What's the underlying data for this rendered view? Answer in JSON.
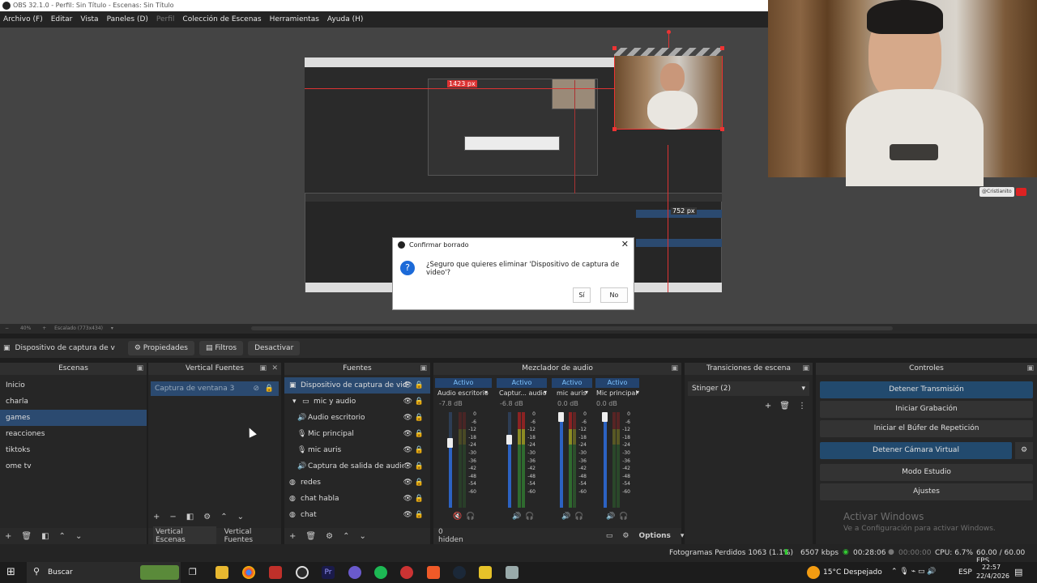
{
  "window": {
    "title": "OBS 32.1.0 - Perfil: Sin Título - Escenas: Sin Título"
  },
  "menu": [
    "Archivo (F)",
    "Editar",
    "Vista",
    "Paneles (D)",
    "Perfil",
    "Colección de Escenas",
    "Herramientas",
    "Ayuda (H)"
  ],
  "preview": {
    "width_label": "1423 px",
    "height_label": "752 px",
    "zoom": "40%",
    "scaled": "Escalado (773x434)",
    "watermark": "@Cristianito"
  },
  "dialog": {
    "title": "Confirmar borrado",
    "message": "¿Seguro que quieres eliminar 'Dispositivo de captura de video'?",
    "yes": "Sí",
    "no": "No"
  },
  "source_toolbar": {
    "selected": "Dispositivo de captura de v",
    "properties": "Propiedades",
    "filters": "Filtros",
    "deactivate": "Desactivar"
  },
  "scenes": {
    "title": "Escenas",
    "items": [
      "Inicio",
      "charla",
      "games",
      "reacciones",
      "tiktoks",
      "ome tv"
    ],
    "selected_index": 2
  },
  "vertical_sources": {
    "title": "Vertical Fuentes",
    "items": [
      "Captura de ventana 3"
    ],
    "tab1": "Vertical Escenas",
    "tab2": "Vertical Fuentes"
  },
  "sources": {
    "title": "Fuentes",
    "items": [
      "Dispositivo de captura de vid",
      "mic y audio",
      "Audio escritorio",
      "Mic principal",
      "mic auris",
      "Captura de salida de audio",
      "redes",
      "chat habla",
      "chat"
    ]
  },
  "mixer": {
    "title": "Mezclador de audio",
    "hidden": "0 hidden",
    "options": "Options",
    "channels": [
      {
        "active": "Activo",
        "name": "Audio escritorio",
        "db": "-7.8 dB"
      },
      {
        "active": "Activo",
        "name": "Captur... audio",
        "db": "-6.8 dB"
      },
      {
        "active": "Activo",
        "name": "mic auris",
        "db": "0.0 dB"
      },
      {
        "active": "Activo",
        "name": "Mic principal",
        "db": "0.0 dB"
      }
    ],
    "scale": [
      "0",
      "-6",
      "-12",
      "-18",
      "-24",
      "-30",
      "-36",
      "-42",
      "-48",
      "-54",
      "-60"
    ]
  },
  "transitions": {
    "title": "Transiciones de escena",
    "selected": "Stinger (2)"
  },
  "controls": {
    "title": "Controles",
    "buttons": [
      "Detener Transmisión",
      "Iniciar Grabación",
      "Iniciar el Búfer de Repetición",
      "Detener Cámara Virtual",
      "Modo Estudio",
      "Ajustes"
    ],
    "activate_title": "Activar Windows",
    "activate_sub": "Ve a Configuración para activar Windows."
  },
  "status": {
    "dropped": "Fotogramas Perdidos 1063 (1.1%)",
    "bitrate": "6507 kbps",
    "stream_time": "00:28:06",
    "rec_time": "00:00:00",
    "cpu": "CPU: 6.7%",
    "fps": "60.00 / 60.00 FPS"
  },
  "taskbar": {
    "search": "Buscar",
    "weather": "15°C  Despejado",
    "lang": "ESP",
    "time": "22:57",
    "date": "22/4/2026"
  }
}
